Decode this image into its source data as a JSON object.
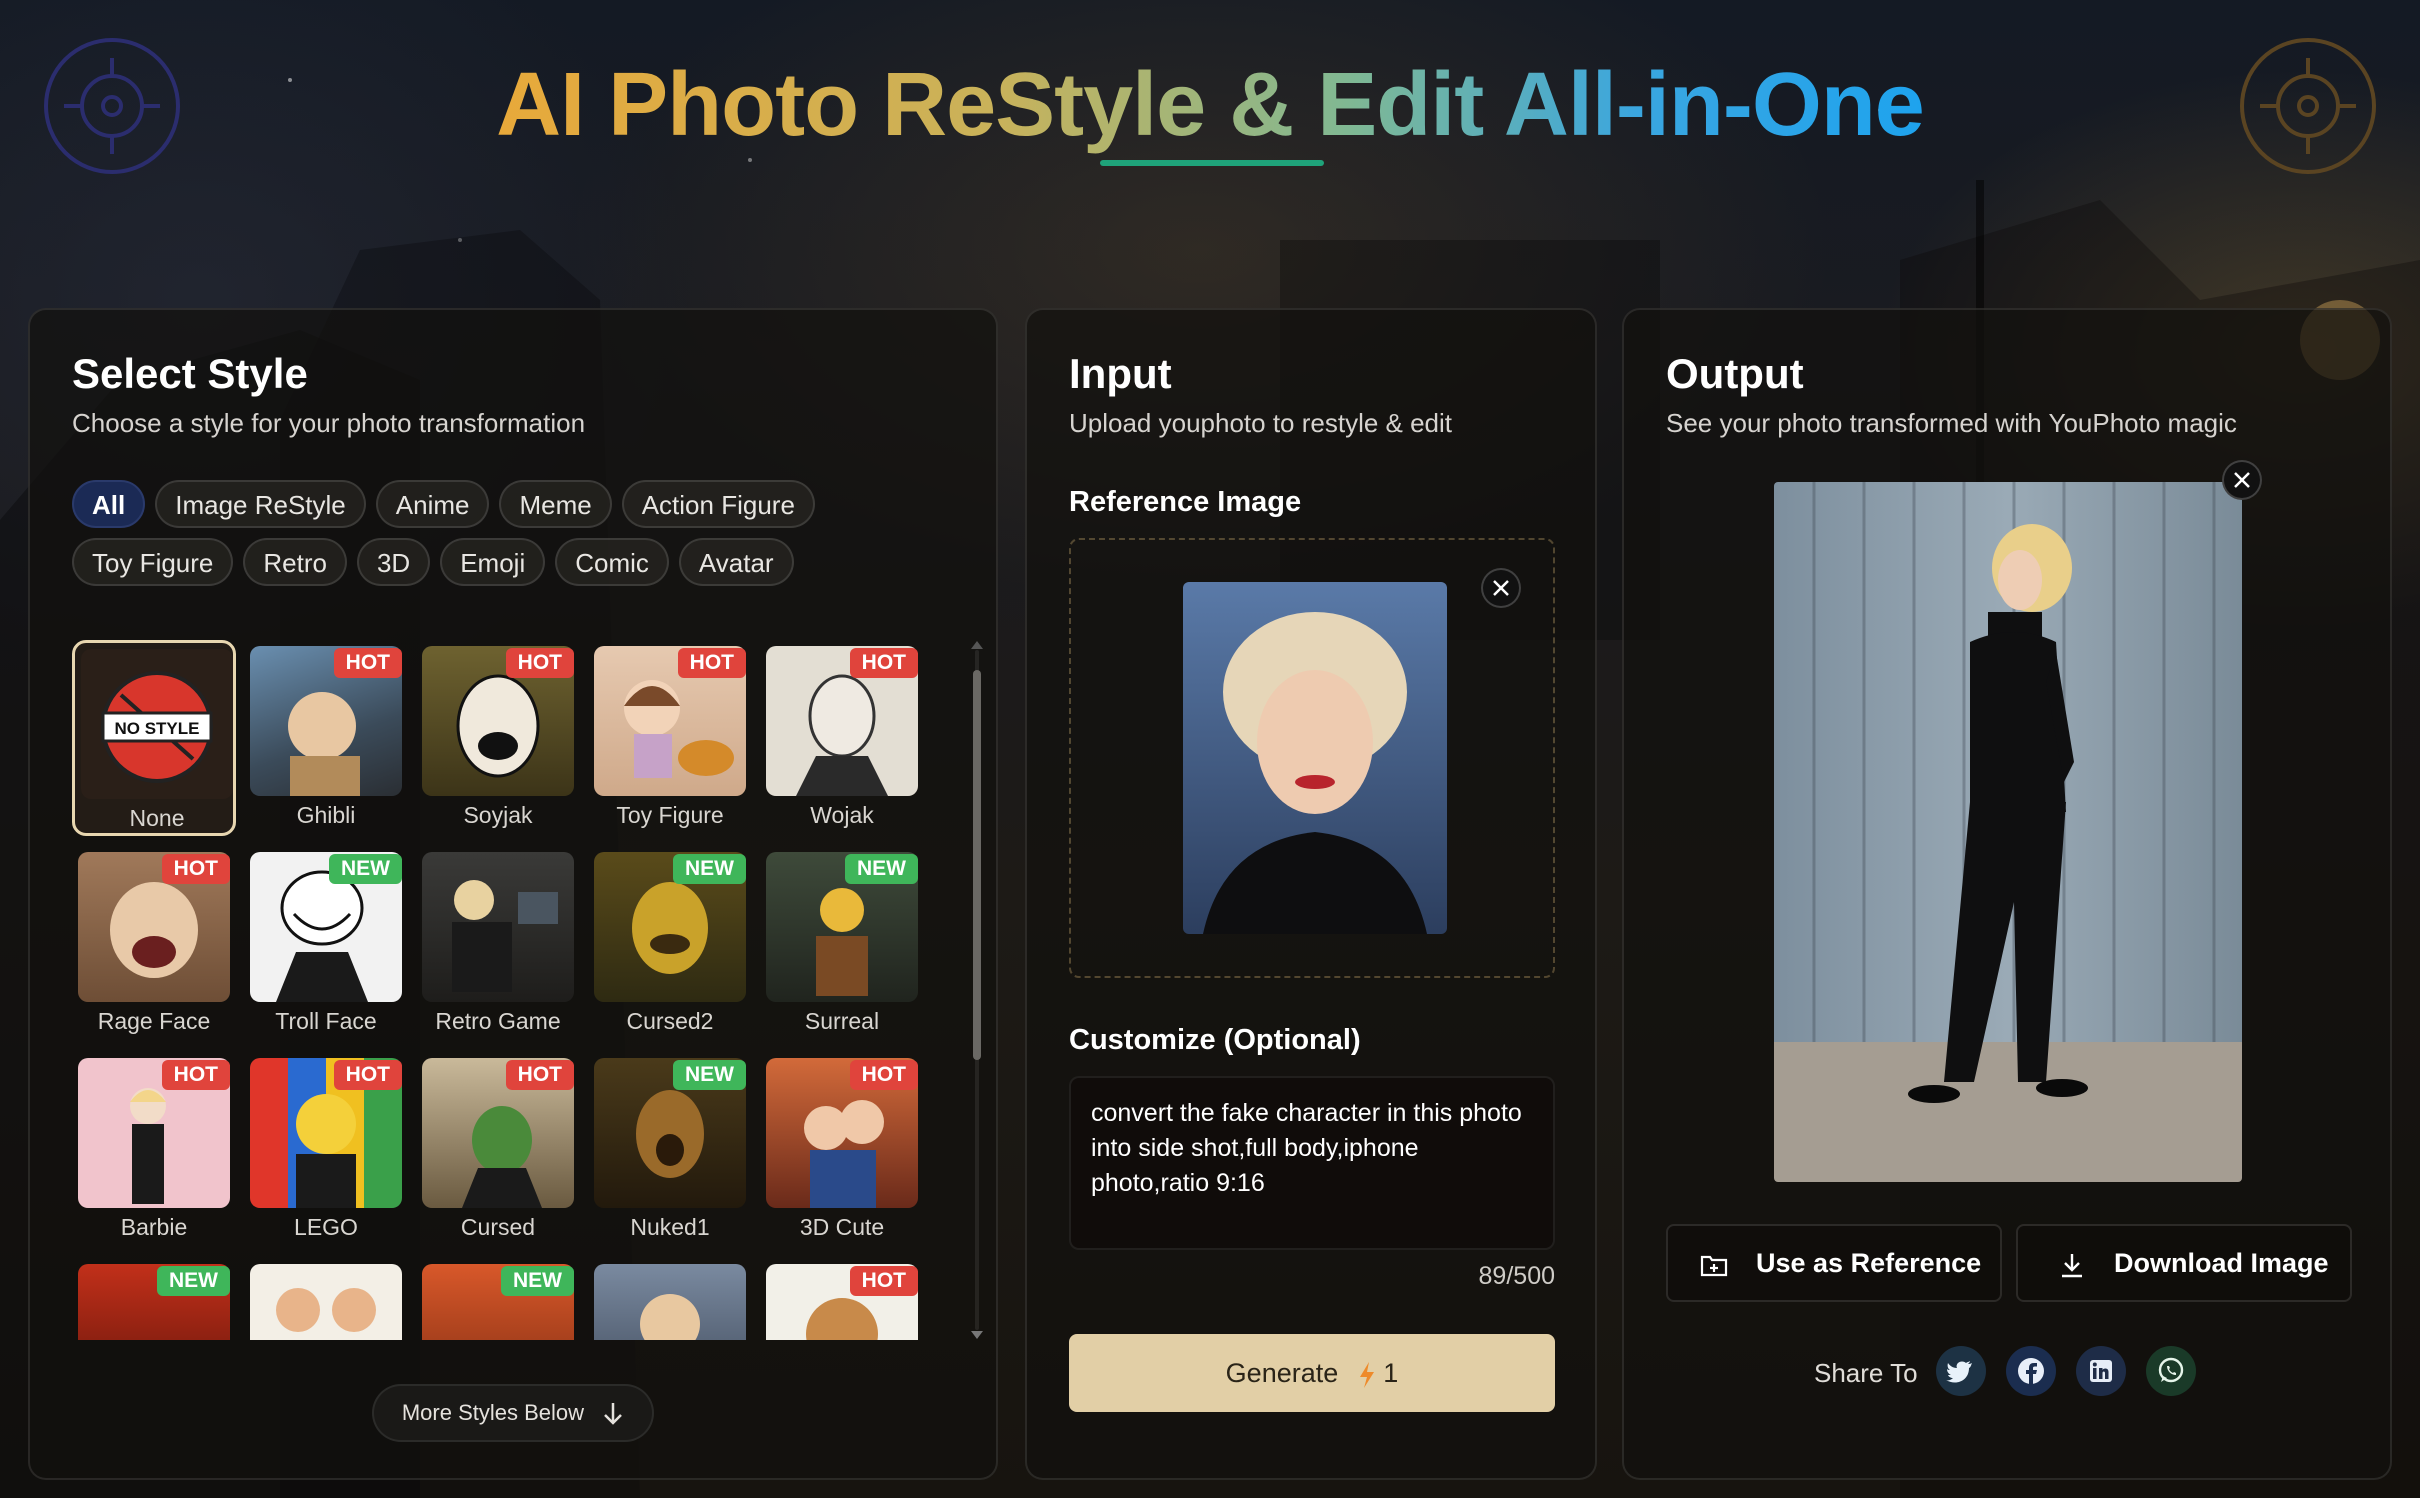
{
  "header": {
    "title": "AI Photo ReStyle & Edit All-in-One"
  },
  "select_style": {
    "title": "Select Style",
    "subtitle": "Choose a style for your photo transformation",
    "filters": [
      "All",
      "Image ReStyle",
      "Anime",
      "Meme",
      "Action Figure",
      "Toy Figure",
      "Retro",
      "3D",
      "Emoji",
      "Comic",
      "Avatar"
    ],
    "active_filter": "All",
    "none_badge_text": "NO STYLE",
    "styles": [
      {
        "label": "None",
        "badge": ""
      },
      {
        "label": "Ghibli",
        "badge": "HOT"
      },
      {
        "label": "Soyjak",
        "badge": "HOT"
      },
      {
        "label": "Toy Figure",
        "badge": "HOT"
      },
      {
        "label": "Wojak",
        "badge": "HOT"
      },
      {
        "label": "Rage Face",
        "badge": "HOT"
      },
      {
        "label": "Troll Face",
        "badge": "NEW"
      },
      {
        "label": "Retro Game",
        "badge": ""
      },
      {
        "label": "Cursed2",
        "badge": "NEW"
      },
      {
        "label": "Surreal",
        "badge": "NEW"
      },
      {
        "label": "Barbie",
        "badge": "HOT"
      },
      {
        "label": "LEGO",
        "badge": "HOT"
      },
      {
        "label": "Cursed",
        "badge": "HOT"
      },
      {
        "label": "Nuked1",
        "badge": "NEW"
      },
      {
        "label": "3D Cute",
        "badge": "HOT"
      },
      {
        "label": "",
        "badge": "NEW"
      },
      {
        "label": "",
        "badge": ""
      },
      {
        "label": "",
        "badge": "NEW"
      },
      {
        "label": "",
        "badge": ""
      },
      {
        "label": "",
        "badge": "HOT"
      }
    ],
    "more_label": "More Styles Below"
  },
  "input": {
    "title": "Input",
    "subtitle": "Upload youphoto to restyle & edit",
    "reference_label": "Reference Image",
    "customize_label": "Customize (Optional)",
    "prompt_text": "convert the fake character in this photo into side shot,full body,iphone photo,ratio 9:16",
    "counter": "89/500",
    "generate_label": "Generate",
    "generate_cost": "1"
  },
  "output": {
    "title": "Output",
    "subtitle": "See your photo transformed with YouPhoto magic",
    "use_reference_label": "Use as Reference",
    "download_label": "Download Image",
    "share_label": "Share To",
    "share_icons": [
      "twitter-icon",
      "facebook-icon",
      "linkedin-icon",
      "whatsapp-icon"
    ]
  },
  "colors": {
    "accent_gold": "#e2cfa6",
    "hot_badge": "#e0443c",
    "new_badge": "#3fb65a",
    "active_chip": "#1b2a55",
    "title_underline": "#1fa37a"
  }
}
